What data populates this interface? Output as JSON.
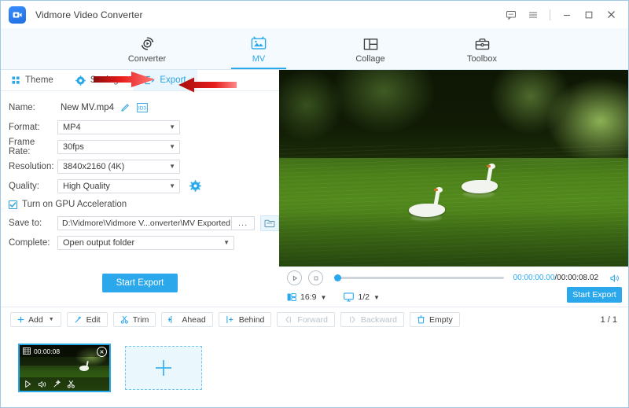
{
  "window": {
    "title": "Vidmore Video Converter",
    "logo_icon": "app-logo-camera-icon",
    "controls": [
      {
        "name": "feedback",
        "icon": "feedback-icon"
      },
      {
        "name": "menu",
        "icon": "hamburger-menu-icon"
      },
      {
        "name": "minimize",
        "icon": "minimize-icon"
      },
      {
        "name": "maximize",
        "icon": "maximize-icon"
      },
      {
        "name": "close",
        "icon": "close-icon"
      }
    ]
  },
  "nav": {
    "items": [
      {
        "label": "Converter",
        "icon": "converter-icon",
        "active": false
      },
      {
        "label": "MV",
        "icon": "mv-icon",
        "active": true
      },
      {
        "label": "Collage",
        "icon": "collage-icon",
        "active": false
      },
      {
        "label": "Toolbox",
        "icon": "toolbox-icon",
        "active": false
      }
    ],
    "active_color": "#29a9e9"
  },
  "subtabs": [
    {
      "label": "Theme",
      "icon": "theme-grid-icon",
      "active": false
    },
    {
      "label": "Settings",
      "icon": "settings-gear-icon",
      "active": false
    },
    {
      "label": "Export",
      "icon": "export-icon",
      "active": true
    }
  ],
  "form": {
    "name": {
      "label": "Name:",
      "value": "New MV.mp4",
      "edit_icon": "pencil-edit-icon",
      "id3_icon": "id3-tag-icon"
    },
    "format": {
      "label": "Format:",
      "value": "MP4"
    },
    "frame_rate": {
      "label": "Frame Rate:",
      "value": "30fps"
    },
    "resolution": {
      "label": "Resolution:",
      "value": "3840x2160 (4K)"
    },
    "quality": {
      "label": "Quality:",
      "value": "High Quality",
      "gear_icon": "quality-settings-gear-icon"
    },
    "gpu": {
      "label": "Turn on GPU Acceleration",
      "checked": true
    },
    "save_to": {
      "label": "Save to:",
      "value": "D:\\Vidmore\\Vidmore V...onverter\\MV Exported",
      "browse_label": "...",
      "folder_icon": "open-folder-icon"
    },
    "complete": {
      "label": "Complete:",
      "value": "Open output folder"
    },
    "start_export_label": "Start Export"
  },
  "player": {
    "play_icon": "play-icon",
    "stop_icon": "stop-icon",
    "current_time": "00:00:00.00",
    "separator": "/",
    "total_time": "00:00:08.02",
    "volume_icon": "volume-icon",
    "aspect_ratio": {
      "label": "16:9",
      "icon": "aspect-ratio-icon"
    },
    "screen_size": {
      "label": "1/2",
      "icon": "screen-size-icon"
    },
    "export_label": "Start Export",
    "progress_percent": 0
  },
  "toolbar": {
    "buttons": [
      {
        "label": "Add",
        "icon": "plus-icon",
        "caret": true,
        "disabled": false
      },
      {
        "label": "Edit",
        "icon": "magic-wand-icon",
        "caret": false,
        "disabled": false
      },
      {
        "label": "Trim",
        "icon": "scissors-icon",
        "caret": false,
        "disabled": false
      },
      {
        "label": "Ahead",
        "icon": "insert-ahead-icon",
        "caret": false,
        "disabled": false
      },
      {
        "label": "Behind",
        "icon": "insert-behind-icon",
        "caret": false,
        "disabled": false
      },
      {
        "label": "Forward",
        "icon": "move-forward-icon",
        "caret": false,
        "disabled": true
      },
      {
        "label": "Backward",
        "icon": "move-backward-icon",
        "caret": false,
        "disabled": true
      },
      {
        "label": "Empty",
        "icon": "trash-icon",
        "caret": false,
        "disabled": false
      }
    ],
    "page_indicator": "1 / 1"
  },
  "clips": {
    "items": [
      {
        "duration": "00:00:08",
        "film_icon": "film-strip-icon",
        "close_icon": "remove-clip-icon",
        "actions": [
          "play-icon",
          "volume-icon",
          "magic-wand-icon",
          "scissors-icon"
        ]
      }
    ],
    "add_slot_icon": "plus-icon"
  },
  "annotations": [
    {
      "name": "arrow-pointing-to-export-tab",
      "color": "#e01b1b",
      "direction": "right"
    },
    {
      "name": "arrow-pointing-to-start-export-button",
      "color": "#e01b1b",
      "direction": "left"
    }
  ],
  "colors": {
    "accent": "#2ba8ec",
    "nav_active": "#29a9e9",
    "arrow_red": "#e01b1b",
    "panel_bg": "#f4fafe"
  }
}
